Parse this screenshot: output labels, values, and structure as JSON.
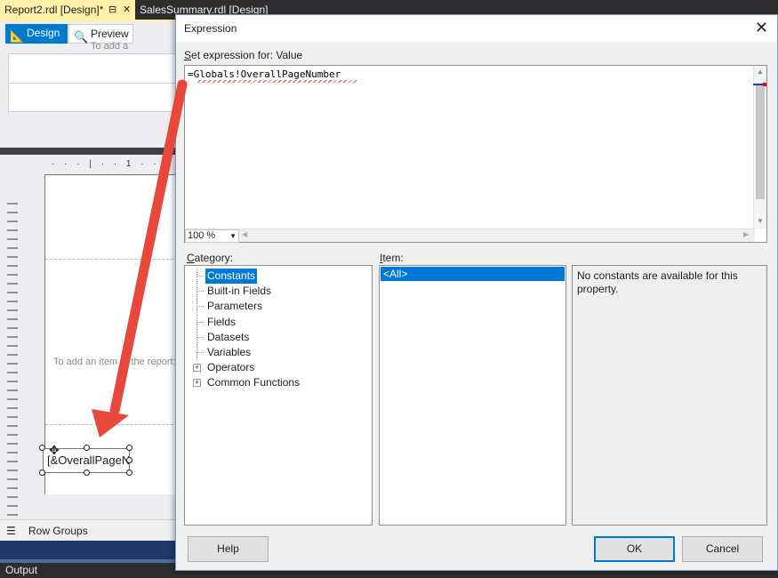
{
  "doc_tabs": {
    "active": "Report2.rdl [Design]*",
    "pin_glyph": "⊟",
    "close_glyph": "✕",
    "inactive": "SalesSummary.rdl [Design]"
  },
  "designer": {
    "design_tab": "Design",
    "preview_tab": "Preview",
    "ruler_text": "· · · | · · 1 · ·",
    "hint_top": "To add a",
    "hint_body": "To add an item to the report:",
    "textbox_value": "[&OverallPageNo",
    "row_groups": "Row Groups",
    "output": "Output"
  },
  "dialog": {
    "title": "Expression",
    "close_glyph": "✕",
    "set_expression_for_prefix": "S",
    "set_expression_for_rest": "et expression for: Value",
    "expression": "=Globals!OverallPageNumber",
    "zoom": "100 %",
    "category_prefix": "C",
    "category_rest": "ategory:",
    "item_prefix": "I",
    "item_rest": "tem:",
    "categories": [
      {
        "label": "Constants",
        "selected": true,
        "expandable": false
      },
      {
        "label": "Built-in Fields",
        "selected": false,
        "expandable": false
      },
      {
        "label": "Parameters",
        "selected": false,
        "expandable": false
      },
      {
        "label": "Fields",
        "selected": false,
        "expandable": false
      },
      {
        "label": "Datasets",
        "selected": false,
        "expandable": false
      },
      {
        "label": "Variables",
        "selected": false,
        "expandable": false
      },
      {
        "label": "Operators",
        "selected": false,
        "expandable": true
      },
      {
        "label": "Common Functions",
        "selected": false,
        "expandable": true
      }
    ],
    "items": [
      "<All>"
    ],
    "description": "No constants are available for this property.",
    "help_button": "Help",
    "ok_button": "OK",
    "cancel_button": "Cancel"
  },
  "colors": {
    "accent": "#0078d7",
    "annotation_arrow": "#e8473c",
    "active_tab": "#fff1a8"
  }
}
